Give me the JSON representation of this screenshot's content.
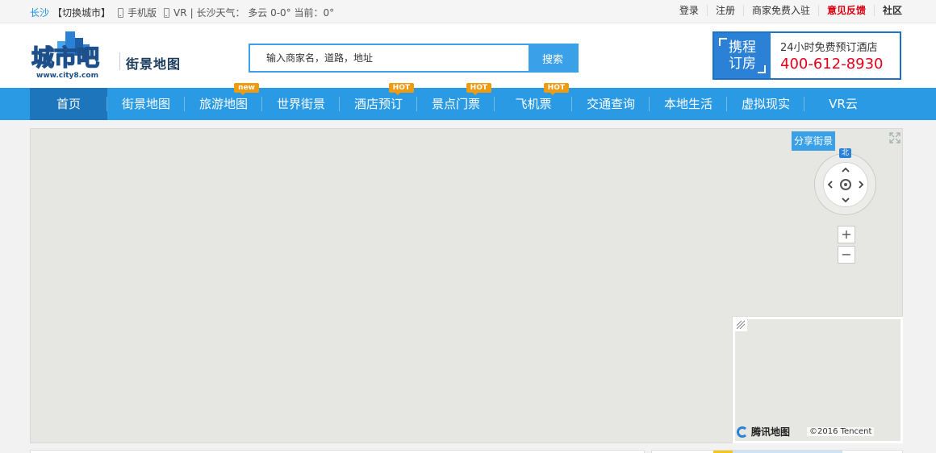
{
  "topbar": {
    "city": "长沙",
    "switch_city": "【切换城市】",
    "mobile": "手机版",
    "vr": "VR",
    "weather": "| 长沙天气： 多云 0-0° 当前：0°",
    "links": [
      "登录",
      "注册",
      "商家免费入驻",
      "意见反馈",
      "社区"
    ]
  },
  "header": {
    "logo_domain": "www.city8.com",
    "logo_text": "城市吧",
    "site_title": "街景地图",
    "search_placeholder": "输入商家名，道路，地址",
    "search_button": "搜索",
    "ctrip_badge_line1": "携程",
    "ctrip_badge_line2": "订房",
    "ctrip_text": "24小时免费预订酒店",
    "ctrip_phone": "400-612-8930"
  },
  "nav": {
    "items": [
      {
        "label": "首页",
        "tag": ""
      },
      {
        "label": "街景地图",
        "tag": ""
      },
      {
        "label": "旅游地图",
        "tag": "new"
      },
      {
        "label": "世界街景",
        "tag": ""
      },
      {
        "label": "酒店预订",
        "tag": "HOT"
      },
      {
        "label": "景点门票",
        "tag": "HOT"
      },
      {
        "label": "飞机票",
        "tag": "HOT"
      },
      {
        "label": "交通查询",
        "tag": ""
      },
      {
        "label": "本地生活",
        "tag": ""
      },
      {
        "label": "虚拟现实",
        "tag": ""
      },
      {
        "label": "VR云",
        "tag": ""
      }
    ]
  },
  "map": {
    "share_button": "分享街景",
    "north_label": "北",
    "zoom_in": "+",
    "zoom_out": "−",
    "minimap_brand": "腾讯地图",
    "minimap_copyright": "©2016 Tencent"
  },
  "colors": {
    "nav_bg": "#2a9ae4",
    "nav_active": "#1d76bc",
    "accent": "#3aa0e8",
    "hot_tag": "#f09a10",
    "feedback": "#d7000f",
    "phone": "#e3001b"
  }
}
